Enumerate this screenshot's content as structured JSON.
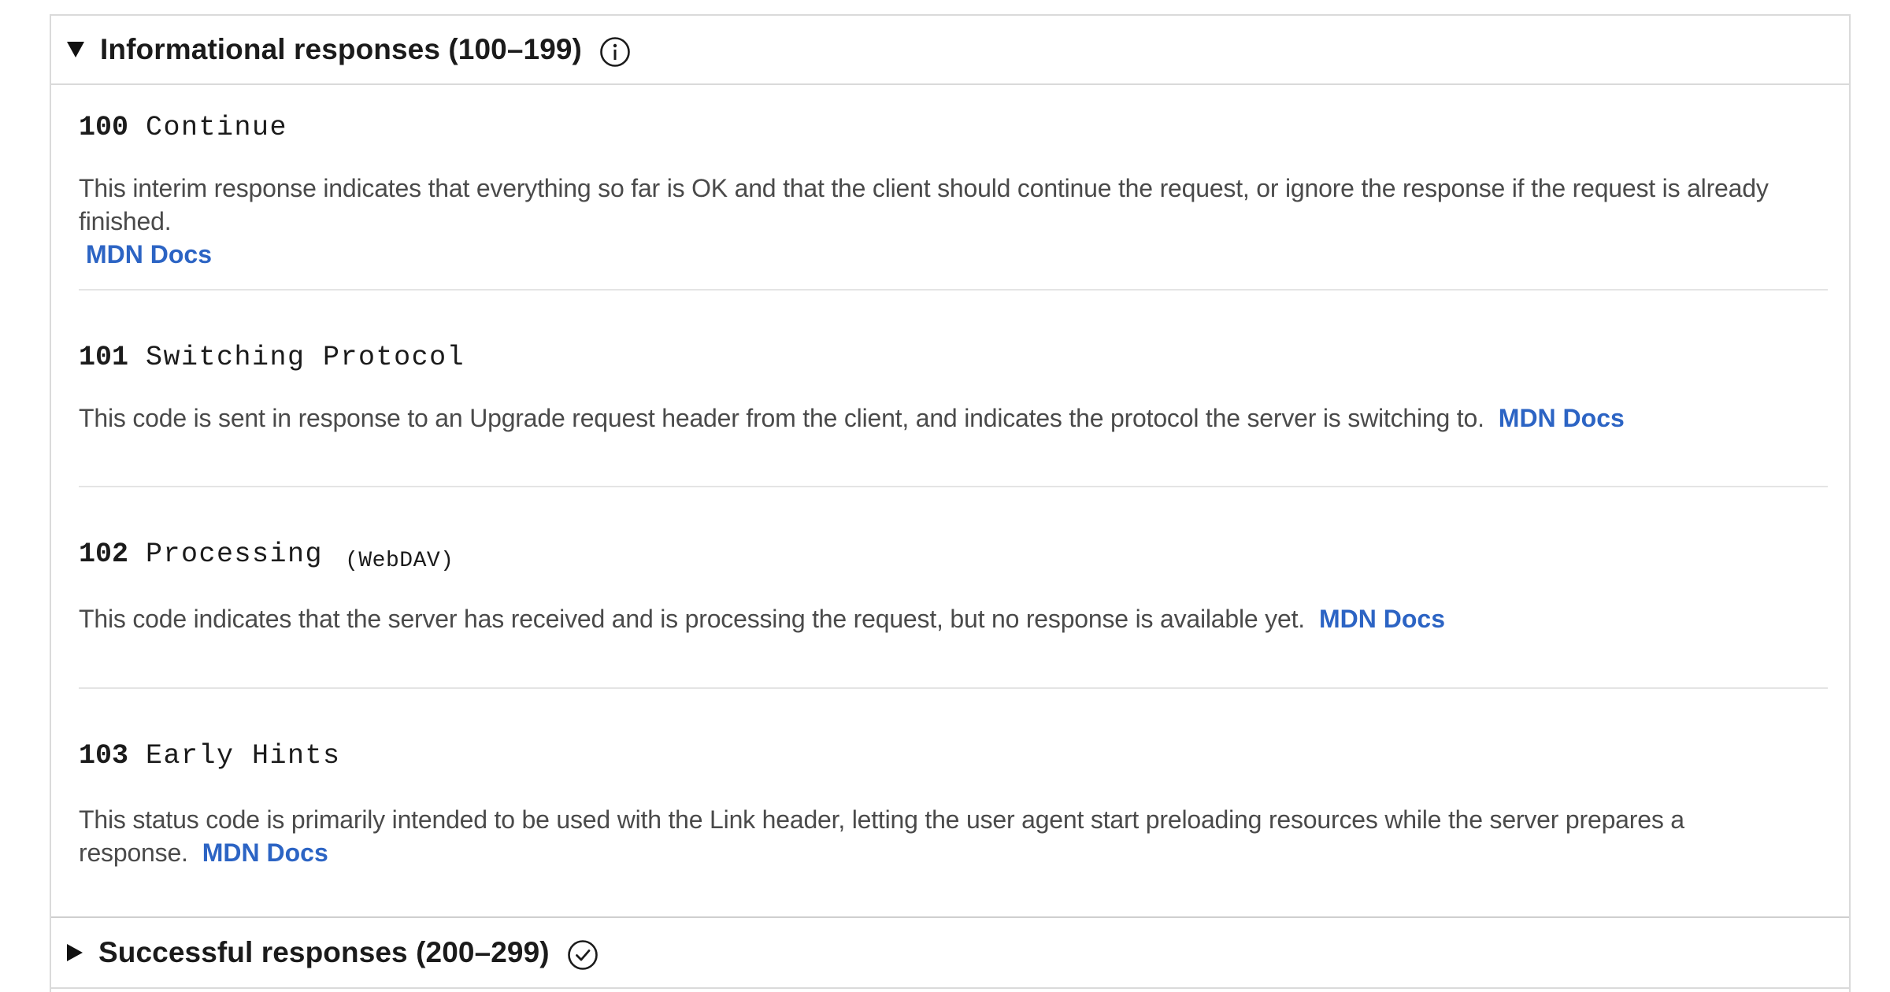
{
  "sections": [
    {
      "title": "Informational responses (100–199)",
      "icon": "info-circle-icon",
      "expanded": true
    },
    {
      "title": "Successful responses (200–299)",
      "icon": "check-circle-icon",
      "expanded": false
    }
  ],
  "entries": [
    {
      "code": "100",
      "name": "Continue",
      "tag": "",
      "description": "This interim response indicates that everything so far is OK and that the client should continue the request, or ignore the response if the request is already finished.",
      "link": "MDN Docs"
    },
    {
      "code": "101",
      "name": "Switching Protocol",
      "tag": "",
      "description": "This code is sent in response to an Upgrade request header from the client, and indicates the protocol the server is switching to.",
      "link": "MDN Docs"
    },
    {
      "code": "102",
      "name": "Processing",
      "tag": "(WebDAV)",
      "description": "This code indicates that the server has received and is processing the request, but no response is available yet.",
      "link": "MDN Docs"
    },
    {
      "code": "103",
      "name": "Early Hints",
      "tag": "",
      "description": "This status code is primarily intended to be used with the Link header, letting the user agent start preloading resources while the server prepares a response.",
      "link": "MDN Docs"
    }
  ],
  "colors": {
    "link": "#2c64c4",
    "text": "#1b1b1b",
    "muted": "#4a4a4a",
    "border": "#dadada"
  }
}
